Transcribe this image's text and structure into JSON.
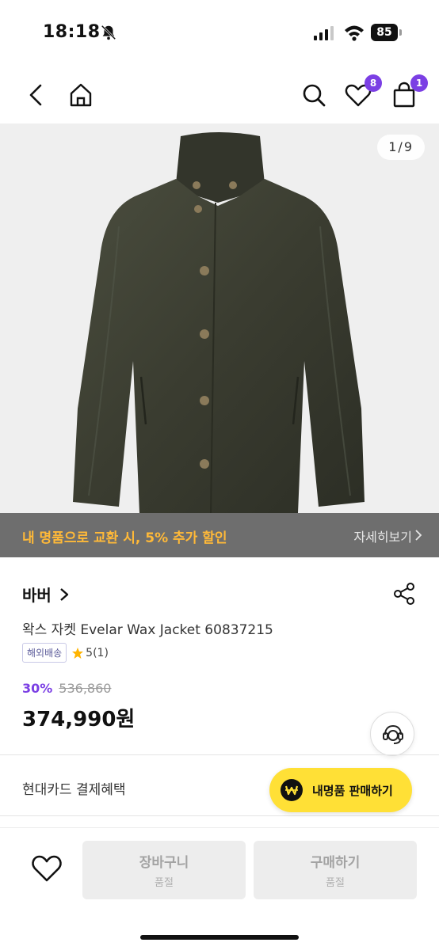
{
  "status_bar": {
    "time": "18:18",
    "battery": "85"
  },
  "header": {
    "wishlist_badge": "8",
    "cart_badge": "1",
    "icons": [
      "back-arrow-icon",
      "home-icon",
      "search-icon",
      "heart-icon",
      "shopping-bag-icon"
    ]
  },
  "product_image": {
    "counter": "1/9",
    "promo_text": "내 명품으로 교환 시, 5% 추가 할인",
    "promo_more": "자세히보기"
  },
  "product": {
    "brand": "바버",
    "name": "왁스 자켓 Evelar Wax Jacket 60837215",
    "tag": "해외배송",
    "rating": "5(1)",
    "discount": "30%",
    "original_price": "536,860",
    "price": "374,990원"
  },
  "benefits": {
    "card_benefit": "현대카드 결제혜택"
  },
  "sell_button": {
    "label": "내명품 판매하기"
  },
  "bottom_bar": {
    "cart_label": "장바구니",
    "cart_sub": "품절",
    "buy_label": "구매하기",
    "buy_sub": "품절"
  },
  "colors": {
    "accent": "#7b3fe4",
    "promo": "#ffb938",
    "sell_button": "#ffe036"
  }
}
